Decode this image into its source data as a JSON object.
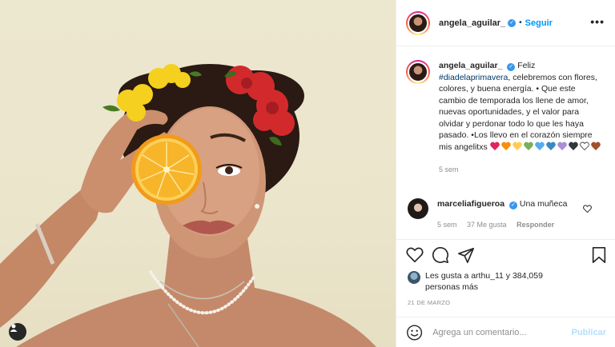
{
  "post": {
    "author": "angela_aguilar_",
    "follow_label": "Seguir",
    "header_dot": "•",
    "more_label": "•••",
    "icons": {
      "verified": "verified-badge-icon",
      "more": "more-options-icon",
      "like": "heart-icon",
      "comment": "comment-icon",
      "share": "share-icon",
      "save": "bookmark-icon",
      "emoji": "emoji-icon",
      "photo_user": "user-tag-icon"
    },
    "colors": {
      "accent": "#0095f6",
      "verified": "#3897f0",
      "hashtag": "#00376b",
      "muted": "#8e8e8e"
    }
  },
  "caption": {
    "username": "angela_aguilar_",
    "text_intro": "Feliz",
    "hashtag": "#diadelaprimavera",
    "text_body": ", celebremos con flores, colores, y buena energía. • Que este cambio de temporada los llene de amor, nuevas oportunidades, y el valor para olvidar y perdonar todo lo que les haya pasado. •Los llevo en el corazón siempre mis angelitxs",
    "hearts": [
      "#e0245e",
      "#f4900c",
      "#fdcb58",
      "#78b159",
      "#55acee",
      "#3b88c3",
      "#aa8ed6",
      "#31373d",
      "#ffffff",
      "#a0522d"
    ],
    "time": "5 sem"
  },
  "comment": {
    "username": "marceliafigueroa",
    "text": "Una muñeca",
    "time": "5 sem",
    "likes": "37 Me gusta",
    "reply": "Responder"
  },
  "likes": {
    "text": "Les gusta a arthu_11 y 384,059 personas más"
  },
  "date": "21 DE MARZO",
  "add_comment": {
    "placeholder": "Agrega un comentario...",
    "publish": "Publicar"
  }
}
